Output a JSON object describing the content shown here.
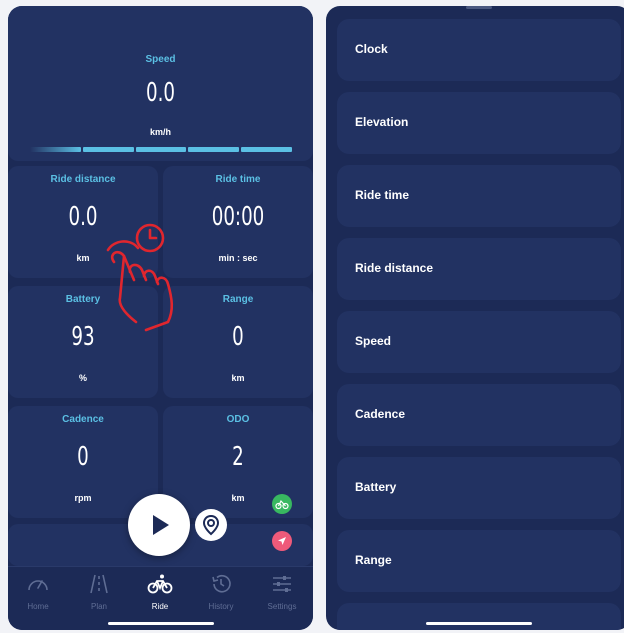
{
  "ride": {
    "speed": {
      "label": "Speed",
      "value": "0.0",
      "unit": "km/h"
    },
    "ride_distance": {
      "label": "Ride distance",
      "value": "0.0",
      "unit": "km"
    },
    "ride_time": {
      "label": "Ride time",
      "value": "00:00",
      "unit": "min : sec"
    },
    "battery": {
      "label": "Battery",
      "value": "93",
      "unit": "%"
    },
    "range": {
      "label": "Range",
      "value": "0",
      "unit": "km"
    },
    "cadence": {
      "label": "Cadence",
      "value": "0",
      "unit": "rpm"
    },
    "odo": {
      "label": "ODO",
      "value": "2",
      "unit": "km"
    }
  },
  "nav": [
    {
      "label": "Home",
      "icon": "speedometer-icon"
    },
    {
      "label": "Plan",
      "icon": "road-icon"
    },
    {
      "label": "Ride",
      "icon": "bicycle-icon"
    },
    {
      "label": "History",
      "icon": "history-icon"
    },
    {
      "label": "Settings",
      "icon": "sliders-icon"
    }
  ],
  "metric_list": [
    "Clock",
    "Elevation",
    "Ride time",
    "Ride distance",
    "Speed",
    "Cadence",
    "Battery",
    "Range"
  ],
  "colors": {
    "background": "#1c2a56",
    "card": "#223262",
    "accent": "#5bc0e4",
    "gesture": "#e0262e",
    "green_badge": "#38b860",
    "pink_badge": "#ef5a7a"
  },
  "gesture_overlay": "tap-and-hold-hand-icon"
}
